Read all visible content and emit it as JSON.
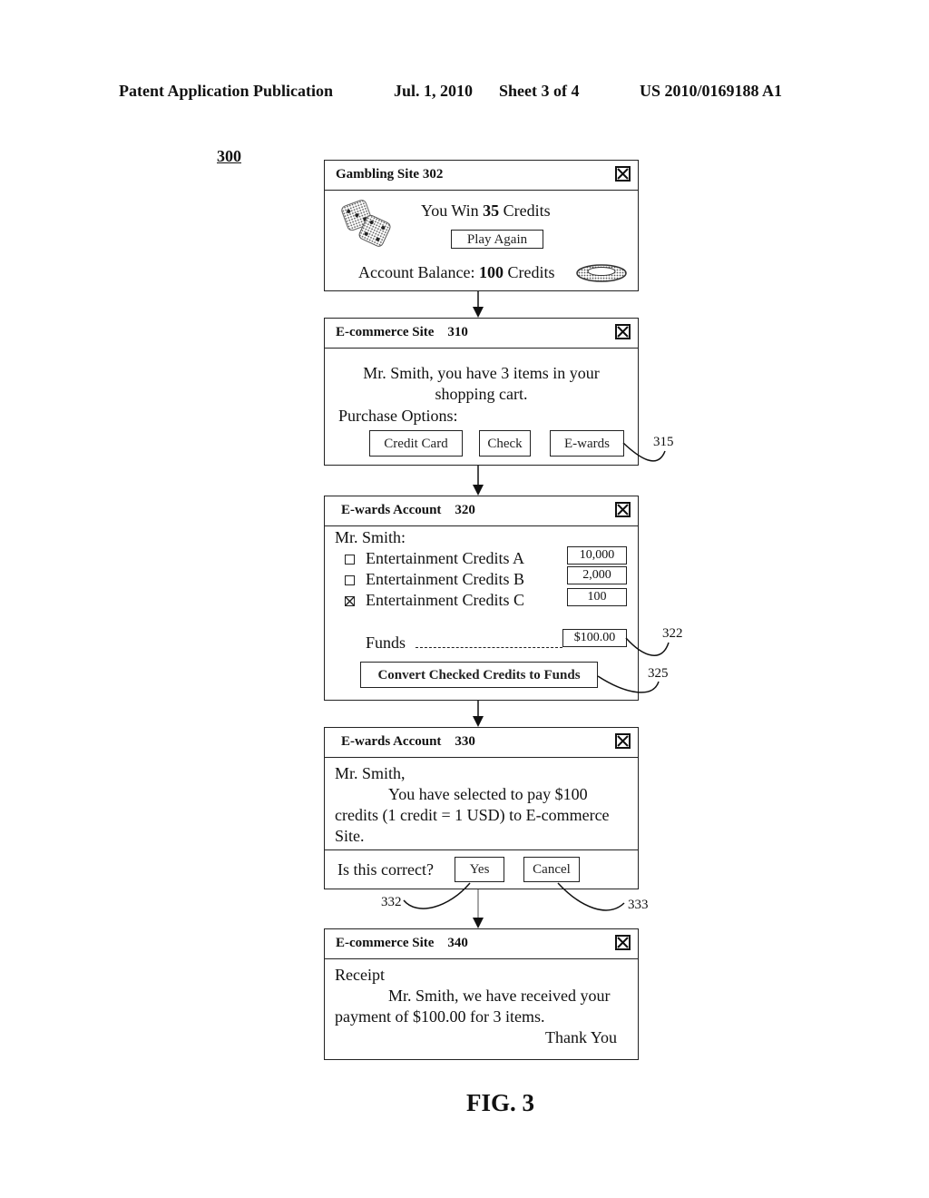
{
  "header": {
    "publication": "Patent Application Publication",
    "date": "Jul. 1, 2010",
    "sheet": "Sheet 3 of 4",
    "number": "US 2010/0169188 A1"
  },
  "figure_ref": "300",
  "figure_caption": "FIG. 3",
  "windows": {
    "gambling": {
      "title": "Gambling Site 302",
      "win_prefix": "You Win ",
      "win_amount": "35",
      "win_suffix": " Credits",
      "play_again": "Play Again",
      "balance_prefix": "Account Balance: ",
      "balance_amount": "100",
      "balance_suffix": " Credits",
      "icons": [
        "dice-icon",
        "casino-chip-icon",
        "close-icon"
      ]
    },
    "ecommerce_310": {
      "title": "E-commerce Site    310",
      "message_line1": "Mr. Smith, you have 3 items in your",
      "message_line2": "shopping cart.",
      "purchase_label": "Purchase Options:",
      "buttons": [
        "Credit Card",
        "Check",
        "E-wards"
      ],
      "callout": "315"
    },
    "ewards_320": {
      "title": "E-wards Account    320",
      "greeting": "Mr. Smith:",
      "credits": [
        {
          "label": "Entertainment Credits A",
          "value": "10,000",
          "checked": false
        },
        {
          "label": "Entertainment Credits B",
          "value": "2,000",
          "checked": false
        },
        {
          "label": "Entertainment Credits C",
          "value": "100",
          "checked": true
        }
      ],
      "funds_label": "Funds",
      "funds_value": "$100.00",
      "convert_button": "Convert Checked Credits to Funds",
      "callout_funds": "322",
      "callout_convert": "325"
    },
    "ewards_330": {
      "title": "E-wards Account    330",
      "line1": "Mr. Smith,",
      "line2": "You have selected to pay $100",
      "line3": "credits (1 credit = 1 USD) to E-commerce",
      "line4": "Site.",
      "question": "Is this correct?",
      "yes": "Yes",
      "cancel": "Cancel",
      "callout_yes": "332",
      "callout_cancel": "333"
    },
    "ecommerce_340": {
      "title": "E-commerce Site    340",
      "line1": "Receipt",
      "line2": "Mr. Smith, we have received your",
      "line3": "payment of $100.00 for 3 items.",
      "line4": "Thank You"
    }
  }
}
